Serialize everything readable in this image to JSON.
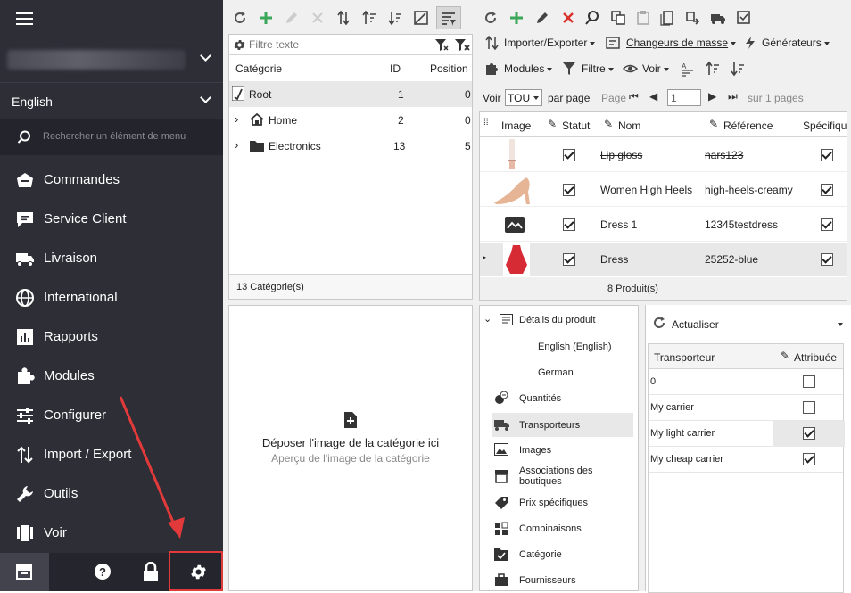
{
  "sidebar": {
    "language": "English",
    "search_placeholder": "Rechercher un élément de menu",
    "items": [
      {
        "label": "Commandes",
        "icon": "cart-icon"
      },
      {
        "label": "Service Client",
        "icon": "chat-icon"
      },
      {
        "label": "Livraison",
        "icon": "truck-icon"
      },
      {
        "label": "International",
        "icon": "globe-icon"
      },
      {
        "label": "Rapports",
        "icon": "bar-chart-icon"
      },
      {
        "label": "Modules",
        "icon": "puzzle-icon"
      },
      {
        "label": "Configurer",
        "icon": "sliders-icon"
      },
      {
        "label": "Import / Export",
        "icon": "import-export-icon"
      },
      {
        "label": "Outils",
        "icon": "wrench-icon"
      },
      {
        "label": "Voir",
        "icon": "columns-icon"
      }
    ]
  },
  "categories": {
    "filter_placeholder": "Filtre texte",
    "columns": [
      "Catégorie",
      "ID",
      "Position"
    ],
    "rows": [
      {
        "name": "Root",
        "id": "1",
        "position": "0"
      },
      {
        "name": "Home",
        "id": "2",
        "position": "0"
      },
      {
        "name": "Electronics",
        "id": "13",
        "position": "5"
      }
    ],
    "footer": "13 Catégorie(s)"
  },
  "image_drop": {
    "title": "Déposer l'image de la catégorie ici",
    "subtitle": "Aperçu de l'image de la catégorie"
  },
  "products": {
    "menu": {
      "import_export": "Importer/Exporter",
      "bulk_changers": "Changeurs de masse",
      "generators": "Générateurs",
      "modules": "Modules",
      "filter": "Filtre",
      "view": "Voir"
    },
    "pager": {
      "show_label": "Voir",
      "per_page_value": "TOU",
      "per_page_label": "par page",
      "page_label": "Page",
      "page_value": "1",
      "total_label": "sur 1 pages"
    },
    "columns": [
      "Image",
      "Statut",
      "Nom",
      "Référence",
      "Spécifiqu"
    ],
    "rows": [
      {
        "name": "Lip gloss",
        "reference": "nars123",
        "status": true,
        "specific": true
      },
      {
        "name": "Women High Heels",
        "reference": "high-heels-creamy",
        "status": true,
        "specific": true
      },
      {
        "name": "Dress 1",
        "reference": "12345testdress",
        "status": true,
        "specific": true
      },
      {
        "name": "Dress",
        "reference": "25252-blue",
        "status": true,
        "specific": true
      }
    ],
    "footer": "8 Produit(s)"
  },
  "details": {
    "header": "Détails du produit",
    "items": [
      "English (English)",
      "German",
      "Quantités",
      "Transporteurs",
      "Images",
      "Associations des boutiques",
      "Prix spécifiques",
      "Combinaisons",
      "Catégorie",
      "Fournisseurs"
    ]
  },
  "carriers": {
    "refresh_label": "Actualiser",
    "columns": [
      "Transporteur",
      "Attribuée"
    ],
    "rows": [
      {
        "name": "0",
        "assigned": false
      },
      {
        "name": "My carrier",
        "assigned": false
      },
      {
        "name": "My light carrier",
        "assigned": true
      },
      {
        "name": "My cheap carrier",
        "assigned": true
      }
    ]
  },
  "colors": {
    "sidebar": "#2d2e36",
    "highlight": "#e23a3a",
    "green": "#3aa657",
    "red": "#d9302c"
  }
}
